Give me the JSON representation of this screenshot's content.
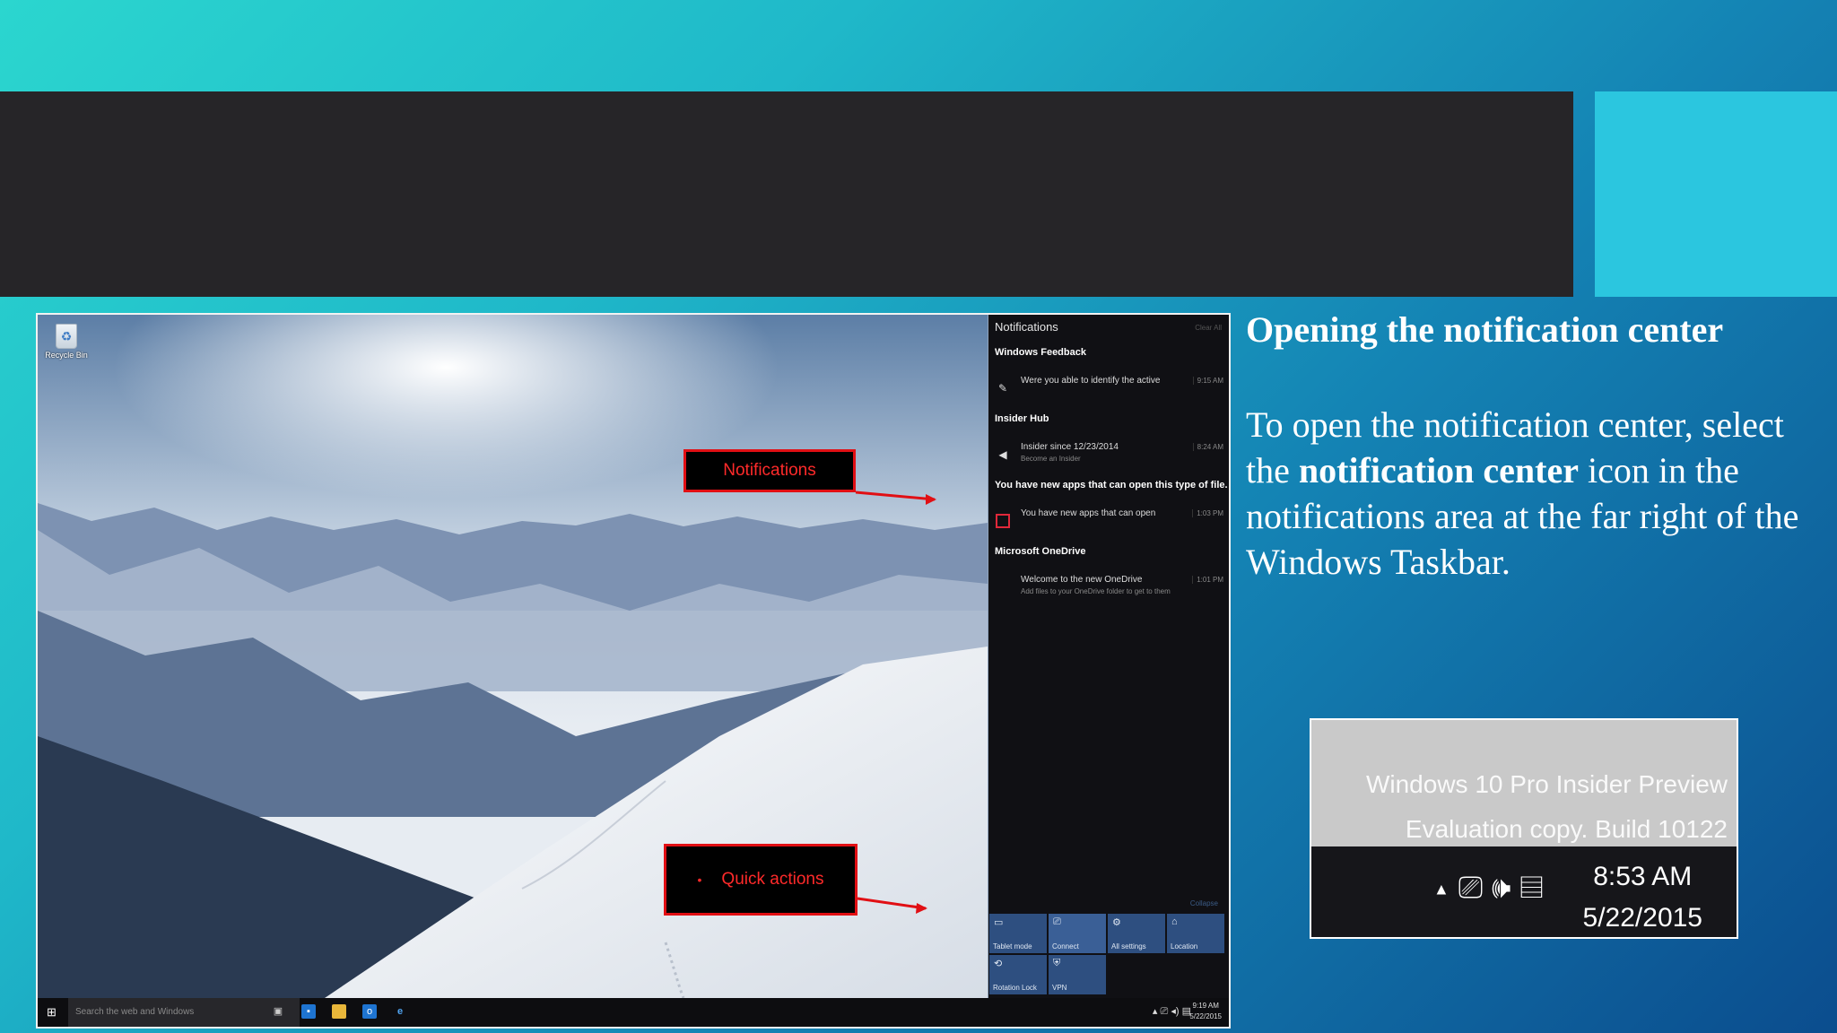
{
  "slide": {
    "heading": "Opening the notification center",
    "body": {
      "part1": "To open the notification center, select the ",
      "bold": "notification center",
      "part2": " icon in the notifications area at the far right of the Windows Taskbar."
    }
  },
  "callouts": {
    "notifications": "Notifications",
    "quick_actions": "Quick actions"
  },
  "desktop": {
    "recycle_bin_label": "Recycle Bin"
  },
  "action_center": {
    "title": "Notifications",
    "clear_all": "Clear All",
    "groups": [
      {
        "name": "Windows Feedback",
        "items": [
          {
            "text": "Were you able to identify the active",
            "sub": "",
            "time": "9:15 AM",
            "icon": "feedback-icon"
          }
        ]
      },
      {
        "name": "Insider Hub",
        "items": [
          {
            "text": "Insider since 12/23/2014",
            "sub": "Become an Insider",
            "time": "8:24 AM",
            "icon": "megaphone-icon"
          }
        ]
      },
      {
        "name": "You have new apps that can open this type of file.",
        "items": [
          {
            "text": "You have new apps that can open",
            "sub": "",
            "time": "1:03 PM",
            "icon": "store-icon"
          }
        ]
      },
      {
        "name": "Microsoft OneDrive",
        "items": [
          {
            "text": "Welcome to the new OneDrive",
            "sub": "Add files to your OneDrive folder to get to them",
            "time": "1:01 PM",
            "icon": "cloud-icon"
          }
        ]
      }
    ],
    "collapse": "Collapse",
    "quick_actions": [
      "Tablet mode",
      "Connect",
      "All settings",
      "Location",
      "Rotation Lock",
      "VPN"
    ]
  },
  "taskbar": {
    "search_placeholder": "Search the web and Windows",
    "time": "9:19 AM",
    "date": "5/22/2015"
  },
  "tray_zoom": {
    "watermark_line1": "Windows 10 Pro Insider Preview",
    "watermark_line2": "Evaluation copy. Build 10122",
    "time": "8:53 AM",
    "date": "5/22/2015"
  },
  "colors": {
    "callout_border": "#e10f14",
    "title_band": "#262528",
    "accent": "#2bc6df",
    "tile": "#2e4f80"
  }
}
